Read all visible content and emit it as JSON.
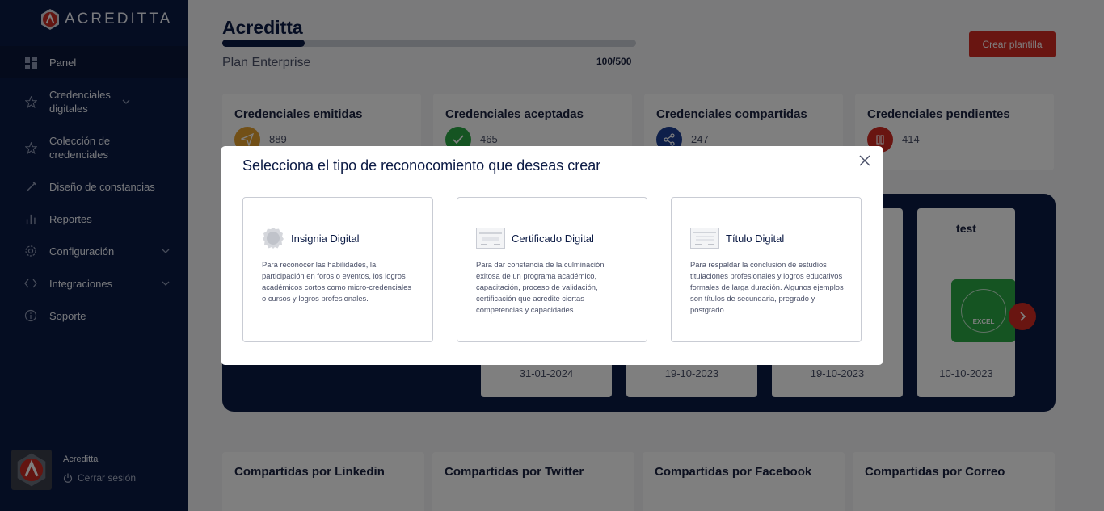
{
  "brand": {
    "name": "ACREDITTA"
  },
  "sidebar": {
    "items": [
      {
        "label": "Panel",
        "icon": "dashboard-icon"
      },
      {
        "label": "Credenciales digitales",
        "icon": "star-icon"
      },
      {
        "label": "Colección de credenciales",
        "icon": "star-icon"
      },
      {
        "label": "Diseño de constancias",
        "icon": "brush-icon"
      },
      {
        "label": "Reportes",
        "icon": "bar-chart-icon"
      },
      {
        "label": "Configuración",
        "icon": "gear-icon"
      },
      {
        "label": "Integraciones",
        "icon": "code-icon"
      },
      {
        "label": "Soporte",
        "icon": "info-icon"
      }
    ]
  },
  "user": {
    "name": "Acreditta",
    "logout": "Cerrar sesión"
  },
  "header": {
    "org": "Acreditta",
    "plan": "Plan Enterprise",
    "usage": "100/500",
    "usage_fraction": 0.2,
    "create_button": "Crear plantilla"
  },
  "stats": [
    {
      "title": "Credenciales emitidas",
      "value": "889",
      "color": "#e5a12e",
      "icon": "send-icon"
    },
    {
      "title": "Credenciales aceptadas",
      "value": "465",
      "color": "#2aa845",
      "icon": "check-icon"
    },
    {
      "title": "Credenciales compartidas",
      "value": "247",
      "color": "#1c3f95",
      "icon": "share-icon"
    },
    {
      "title": "Credenciales pendientes",
      "value": "414",
      "color": "#d32a22",
      "icon": "pause-icon"
    }
  ],
  "carousel": {
    "cards": [
      {
        "name": "",
        "date": "31-01-2024"
      },
      {
        "name": "",
        "date": "19-10-2023"
      },
      {
        "name": "",
        "date": "19-10-2023"
      },
      {
        "name": "test",
        "date": "10-10-2023",
        "badge_text": "EXCEL"
      }
    ]
  },
  "shares": [
    {
      "title": "Compartidas por Linkedin"
    },
    {
      "title": "Compartidas por Twitter"
    },
    {
      "title": "Compartidas por Facebook"
    },
    {
      "title": "Compartidas por Correo"
    }
  ],
  "modal": {
    "title": "Selecciona el tipo de reconocomiento que deseas crear",
    "options": [
      {
        "name": "Insignia Digital",
        "icon": "badge-icon",
        "description": "Para reconocer las habilidades, la participación en foros o eventos, los logros académicos cortos como micro-credenciales o cursos y logros profesionales."
      },
      {
        "name": "Certificado Digital",
        "icon": "certificate-icon",
        "description": "Para dar constancia de la culminación exitosa de un programa académico, capacitación, proceso de validación, certificación que acredite ciertas competencias y capacidades."
      },
      {
        "name": "Título Digital",
        "icon": "diploma-icon",
        "description": "Para respaldar la conclusion de estudios titulaciones profesionales y logros educativos formales de larga duración. Algunos ejemplos son títulos de secundaria, pregrado y postgrado"
      }
    ]
  }
}
